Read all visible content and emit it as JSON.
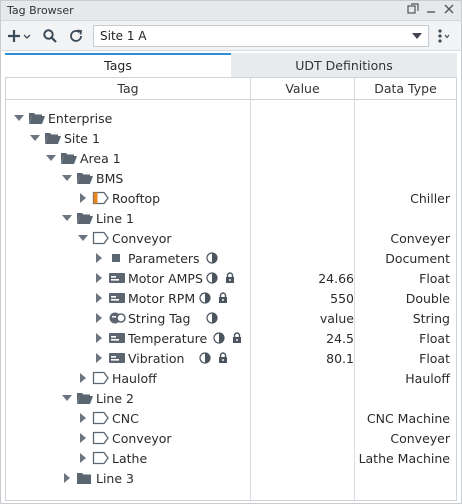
{
  "window": {
    "title": "Tag Browser"
  },
  "toolbar": {
    "provider_value": "Site 1 A"
  },
  "tabs": [
    {
      "label": "Tags"
    },
    {
      "label": "UDT Definitions"
    }
  ],
  "columns": {
    "tag": "Tag",
    "value": "Value",
    "data_type": "Data Type"
  },
  "colors": {
    "accent": "#2d8fd5",
    "folder": "#5b6670",
    "udt_orange": "#e8871e"
  },
  "rows": [
    {
      "name": "Enterprise",
      "value": "",
      "type": "",
      "icon": "folder-open-icon"
    },
    {
      "name": "Site 1",
      "value": "",
      "type": "",
      "icon": "folder-open-icon"
    },
    {
      "name": "Area 1",
      "value": "",
      "type": "",
      "icon": "folder-open-icon"
    },
    {
      "name": "BMS",
      "value": "",
      "type": "",
      "icon": "folder-open-icon"
    },
    {
      "name": "Rooftop",
      "value": "",
      "type": "Chiller",
      "icon": "udt-instance-icon"
    },
    {
      "name": "Line 1",
      "value": "",
      "type": "",
      "icon": "folder-open-icon"
    },
    {
      "name": "Conveyor",
      "value": "",
      "type": "Conveyer",
      "icon": "udt-instance-icon"
    },
    {
      "name": "Parameters",
      "value": "",
      "type": "Document",
      "icon": "document-tag-icon"
    },
    {
      "name": "Motor AMPS",
      "value": "24.66",
      "type": "Float",
      "icon": "memory-tag-icon"
    },
    {
      "name": "Motor RPM",
      "value": "550",
      "type": "Double",
      "icon": "memory-tag-icon"
    },
    {
      "name": "String Tag",
      "value": "value",
      "type": "String",
      "icon": "string-tag-icon"
    },
    {
      "name": "Temperature",
      "value": "24.5",
      "type": "Float",
      "icon": "memory-tag-icon"
    },
    {
      "name": "Vibration",
      "value": "80.1",
      "type": "Float",
      "icon": "memory-tag-icon"
    },
    {
      "name": "Hauloff",
      "value": "",
      "type": "Hauloff",
      "icon": "udt-instance-icon"
    },
    {
      "name": "Line 2",
      "value": "",
      "type": "",
      "icon": "folder-open-icon"
    },
    {
      "name": "CNC",
      "value": "",
      "type": "CNC Machine",
      "icon": "udt-instance-icon"
    },
    {
      "name": "Conveyor",
      "value": "",
      "type": "Conveyer",
      "icon": "udt-instance-icon"
    },
    {
      "name": "Lathe",
      "value": "",
      "type": "Lathe Machine",
      "icon": "udt-instance-icon"
    },
    {
      "name": "Line 3",
      "value": "",
      "type": "",
      "icon": "folder-closed-icon"
    }
  ]
}
